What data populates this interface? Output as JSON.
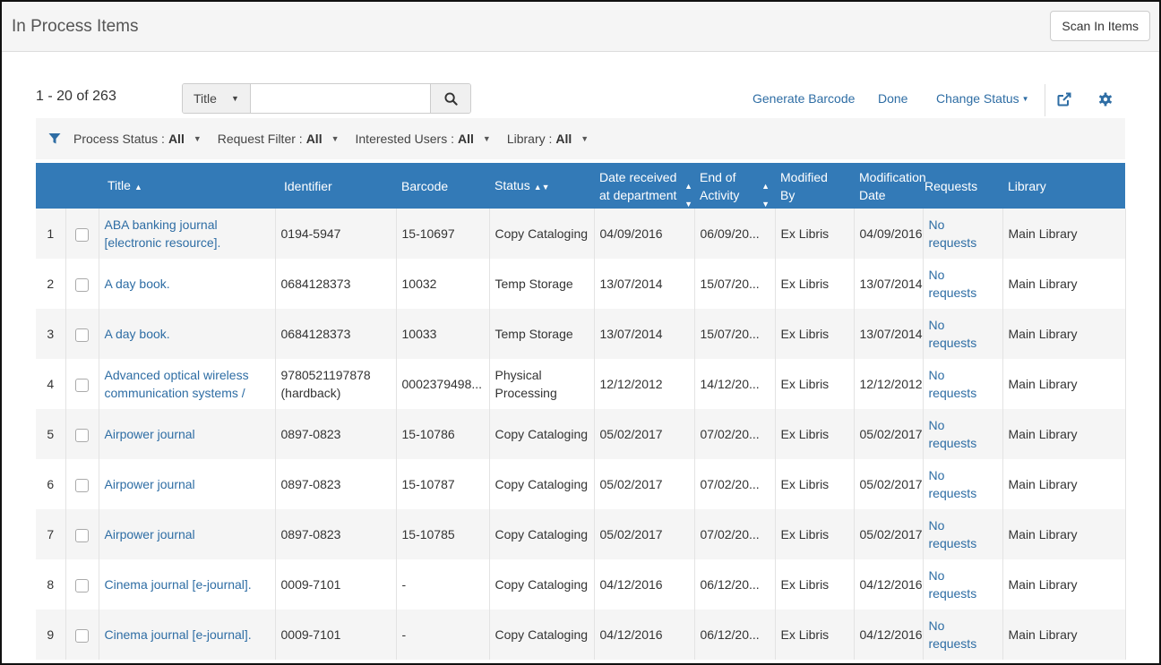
{
  "header": {
    "title": "In Process Items",
    "scan_button": "Scan In Items"
  },
  "toolbar": {
    "count": "1 - 20 of 263",
    "search": {
      "field": "Title",
      "value": "",
      "placeholder": ""
    },
    "actions": {
      "generate_barcode": "Generate Barcode",
      "done": "Done",
      "change_status": "Change Status"
    },
    "icons": [
      "search-icon",
      "external-link-icon",
      "gear-icon"
    ]
  },
  "filters": [
    {
      "label": "Process Status :",
      "value": "All"
    },
    {
      "label": "Request Filter :",
      "value": "All"
    },
    {
      "label": "Interested Users :",
      "value": "All"
    },
    {
      "label": "Library :",
      "value": "All"
    }
  ],
  "columns": [
    "Title",
    "Identifier",
    "Barcode",
    "Status",
    "Date received at department",
    "End of Activity",
    "Modified By",
    "Modification Date",
    "Requests",
    "Library"
  ],
  "rows": [
    {
      "num": "1",
      "title": "ABA banking journal [electronic resource].",
      "identifier": "0194-5947",
      "barcode": "15-10697",
      "status": "Copy Cataloging",
      "date_received": "04/09/2016",
      "end_activity": "06/09/20...",
      "modified_by": "Ex Libris",
      "mod_date": "04/09/2016",
      "requests": "No requests",
      "library": "Main Library"
    },
    {
      "num": "2",
      "title": "A day book.",
      "identifier": "0684128373",
      "barcode": "10032",
      "status": "Temp Storage",
      "date_received": "13/07/2014",
      "end_activity": "15/07/20...",
      "modified_by": "Ex Libris",
      "mod_date": "13/07/2014",
      "requests": "No requests",
      "library": "Main Library"
    },
    {
      "num": "3",
      "title": "A day book.",
      "identifier": "0684128373",
      "barcode": "10033",
      "status": "Temp Storage",
      "date_received": "13/07/2014",
      "end_activity": "15/07/20...",
      "modified_by": "Ex Libris",
      "mod_date": "13/07/2014",
      "requests": "No requests",
      "library": "Main Library"
    },
    {
      "num": "4",
      "title": "Advanced optical wireless communication systems /",
      "identifier": "9780521197878 (hardback)",
      "barcode": "0002379498...",
      "status": "Physical Processing",
      "date_received": "12/12/2012",
      "end_activity": "14/12/20...",
      "modified_by": "Ex Libris",
      "mod_date": "12/12/2012",
      "requests": "No requests",
      "library": "Main Library"
    },
    {
      "num": "5",
      "title": "Airpower journal",
      "identifier": "0897-0823",
      "barcode": "15-10786",
      "status": "Copy Cataloging",
      "date_received": "05/02/2017",
      "end_activity": "07/02/20...",
      "modified_by": "Ex Libris",
      "mod_date": "05/02/2017",
      "requests": "No requests",
      "library": "Main Library"
    },
    {
      "num": "6",
      "title": "Airpower journal",
      "identifier": "0897-0823",
      "barcode": "15-10787",
      "status": "Copy Cataloging",
      "date_received": "05/02/2017",
      "end_activity": "07/02/20...",
      "modified_by": "Ex Libris",
      "mod_date": "05/02/2017",
      "requests": "No requests",
      "library": "Main Library"
    },
    {
      "num": "7",
      "title": "Airpower journal",
      "identifier": "0897-0823",
      "barcode": "15-10785",
      "status": "Copy Cataloging",
      "date_received": "05/02/2017",
      "end_activity": "07/02/20...",
      "modified_by": "Ex Libris",
      "mod_date": "05/02/2017",
      "requests": "No requests",
      "library": "Main Library"
    },
    {
      "num": "8",
      "title": "Cinema journal [e-journal].",
      "identifier": "0009-7101",
      "barcode": "-",
      "status": "Copy Cataloging",
      "date_received": "04/12/2016",
      "end_activity": "06/12/20...",
      "modified_by": "Ex Libris",
      "mod_date": "04/12/2016",
      "requests": "No requests",
      "library": "Main Library"
    },
    {
      "num": "9",
      "title": "Cinema journal [e-journal].",
      "identifier": "0009-7101",
      "barcode": "-",
      "status": "Copy Cataloging",
      "date_received": "04/12/2016",
      "end_activity": "06/12/20...",
      "modified_by": "Ex Libris",
      "mod_date": "04/12/2016",
      "requests": "No requests",
      "library": "Main Library"
    }
  ],
  "row_action_label": "•••",
  "colors": {
    "header_bg": "#337ab7",
    "link": "#2e6da4",
    "accent": "#2e6da4"
  }
}
